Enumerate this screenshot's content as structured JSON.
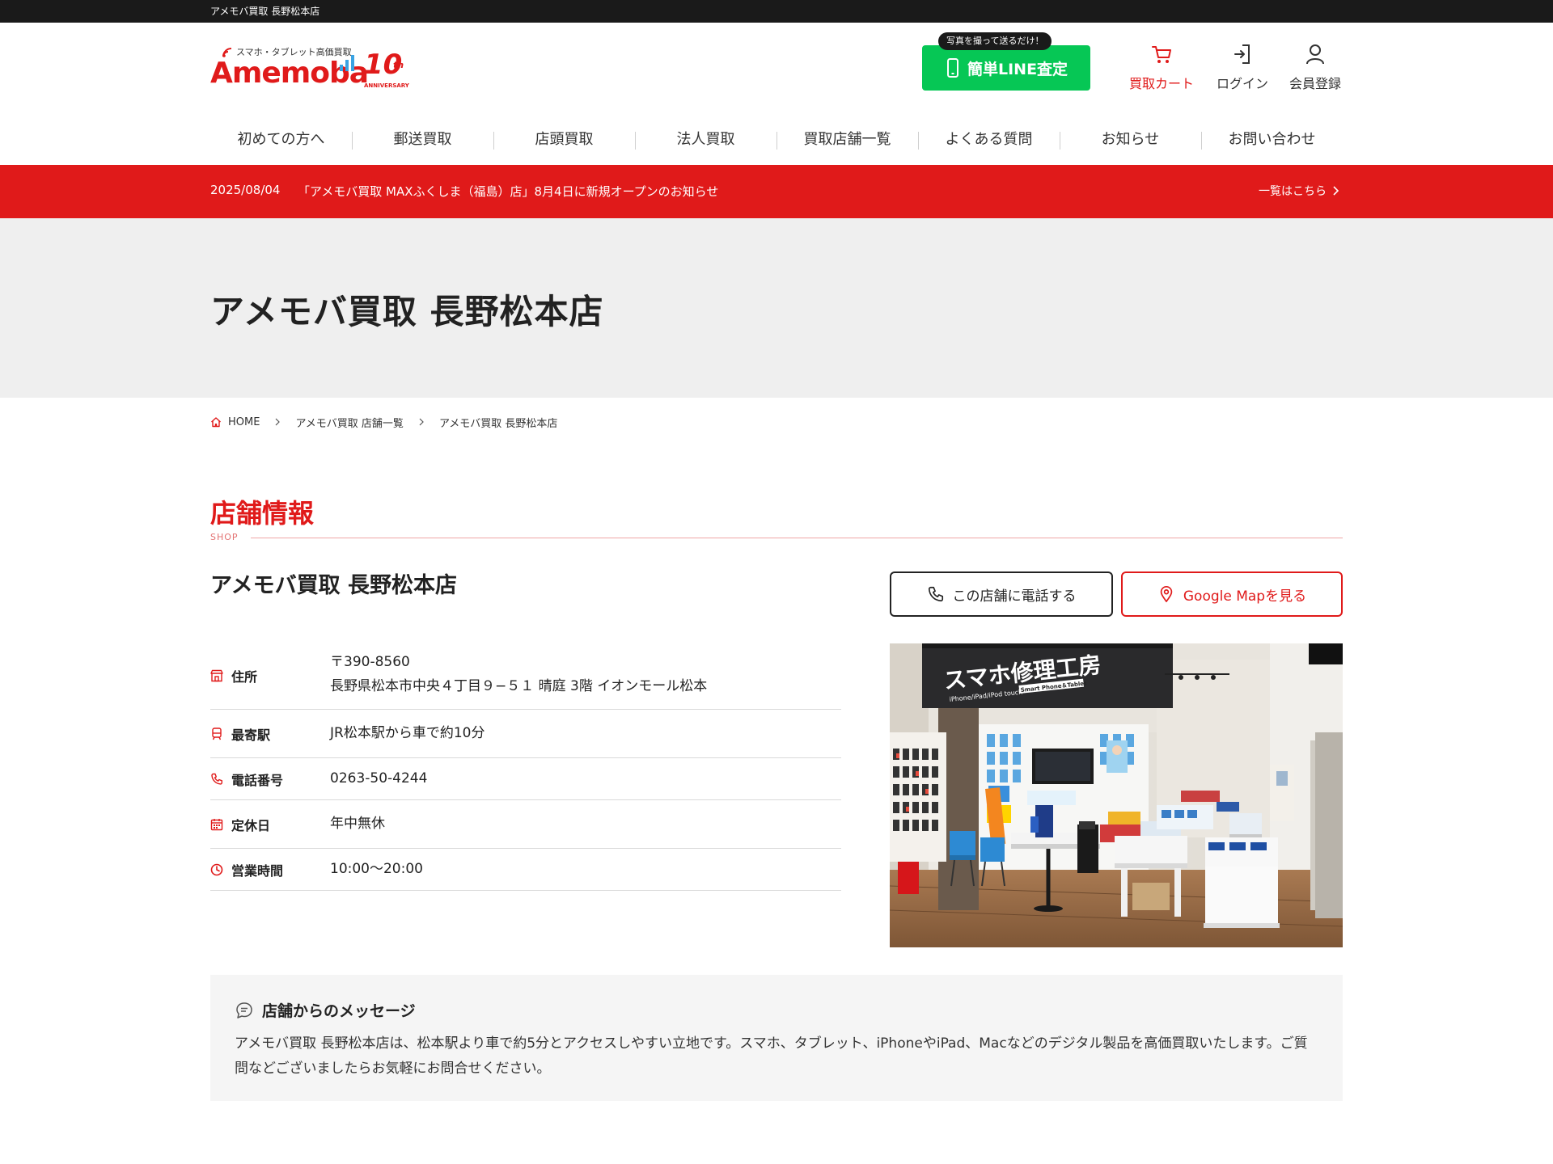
{
  "topbar": {
    "text": "アメモバ買取 長野松本店"
  },
  "logo": {
    "tagline": "スマホ・タブレット高価買取",
    "wordmark": "Amemoba",
    "anniversary_number": "10",
    "anniversary_suffix": "th",
    "anniversary_label": "ANNIVERSARY"
  },
  "header": {
    "line_badge": "写真を撮って送るだけ！",
    "line_button": "簡単LINE査定",
    "cart": "買取カート",
    "login": "ログイン",
    "register": "会員登録"
  },
  "nav": {
    "items": [
      "初めての方へ",
      "郵送買取",
      "店頭買取",
      "法人買取",
      "買取店舗一覧",
      "よくある質問",
      "お知らせ",
      "お問い合わせ"
    ]
  },
  "news": {
    "date": "2025/08/04",
    "title": "「アメモバ買取 MAXふくしま（福島）店」8月4日に新規オープンのお知らせ",
    "more": "一覧はこちら"
  },
  "page": {
    "title": "アメモバ買取 長野松本店"
  },
  "breadcrumb": {
    "home": "HOME",
    "list": "アメモバ買取 店舗一覧",
    "current": "アメモバ買取 長野松本店"
  },
  "section": {
    "title": "店舗情報",
    "subtitle": "SHOP"
  },
  "shop": {
    "name": "アメモバ買取 長野松本店",
    "call_button": "この店舗に電話する",
    "map_button": "Google Mapを見る",
    "info": {
      "address_label": "住所",
      "postal": "〒390-8560",
      "address": "長野県松本市中央４丁目９−５１ 晴庭 3階 イオンモール松本",
      "station_label": "最寄駅",
      "station": "JR松本駅から車で約10分",
      "phone_label": "電話番号",
      "phone": "0263-50-4244",
      "closed_label": "定休日",
      "closed": "年中無休",
      "hours_label": "営業時間",
      "hours": "10:00〜20:00"
    },
    "photo": {
      "sign_main": "スマホ修理工房",
      "sign_sub": "iPhone/iPad/iPod touch",
      "sign_tag": "Smart Phone＆Tablet"
    }
  },
  "message": {
    "title": "店舗からのメッセージ",
    "body": "アメモバ買取 長野松本店は、松本駅より車で約5分とアクセスしやすい立地です。スマホ、タブレット、iPhoneやiPad、Macなどのデジタル製品を高価買取いたします。ご質問などございましたらお気軽にお問合せください。"
  },
  "colors": {
    "brand_red": "#e01a1a",
    "line_green": "#06c755",
    "dark": "#1a1a1a",
    "hero_gray": "#efefef"
  }
}
